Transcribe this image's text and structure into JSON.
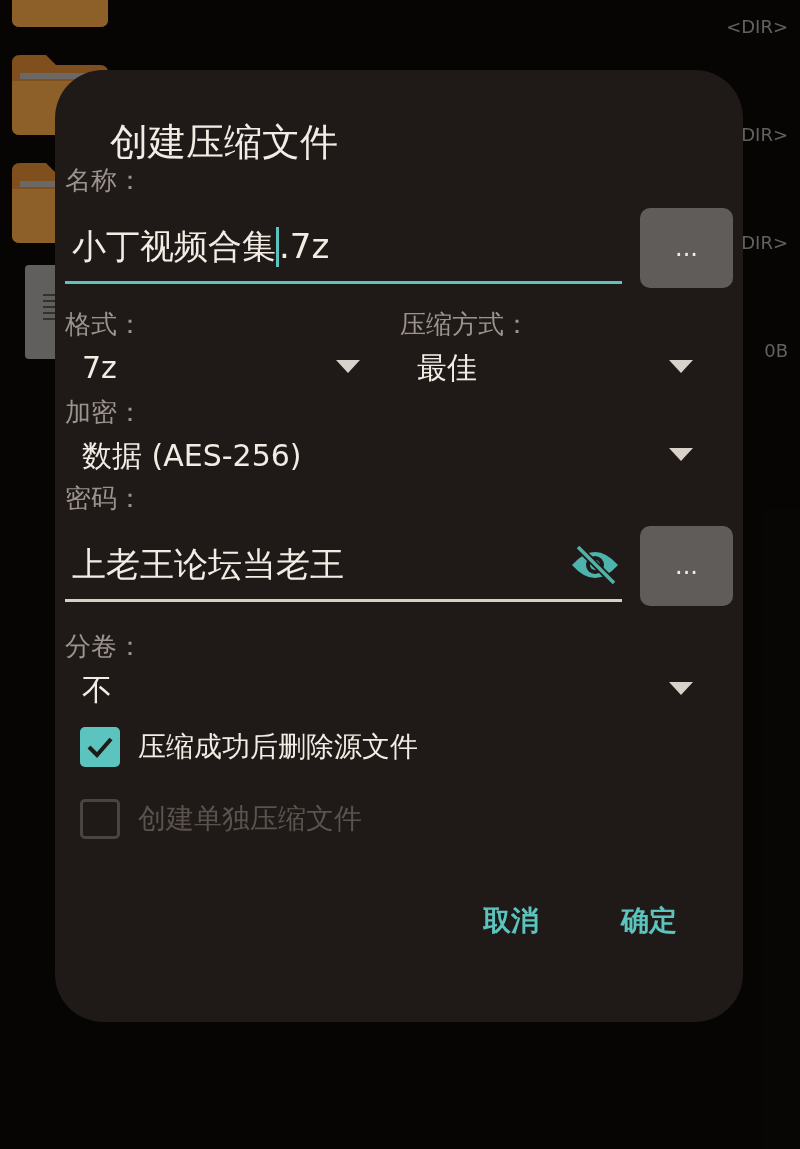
{
  "background_list": [
    {
      "kind": "folder",
      "size": "<DIR>"
    },
    {
      "kind": "folder",
      "size": "DIR>"
    },
    {
      "kind": "folder",
      "size": "DIR>"
    },
    {
      "kind": "file",
      "size": "0B"
    }
  ],
  "dialog": {
    "title": "创建压缩文件",
    "name": {
      "label": "名称：",
      "text_before_cursor": "小丁视频合集",
      "text_after_cursor": ".7z",
      "focused": true,
      "button": "..."
    },
    "format": {
      "label": "格式：",
      "value": "7z"
    },
    "compression": {
      "label": "压缩方式：",
      "value": "最佳"
    },
    "encryption": {
      "label": "加密：",
      "value": "数据 (AES-256)"
    },
    "password": {
      "label": "密码：",
      "value": "上老王论坛当老王",
      "show_password": true,
      "button": "..."
    },
    "split": {
      "label": "分卷：",
      "value": "不"
    },
    "checkboxes": [
      {
        "label": "压缩成功后删除源文件",
        "checked": true,
        "disabled": false
      },
      {
        "label": "创建单独压缩文件",
        "checked": false,
        "disabled": true
      }
    ],
    "buttons": [
      "取消",
      "确定"
    ]
  }
}
